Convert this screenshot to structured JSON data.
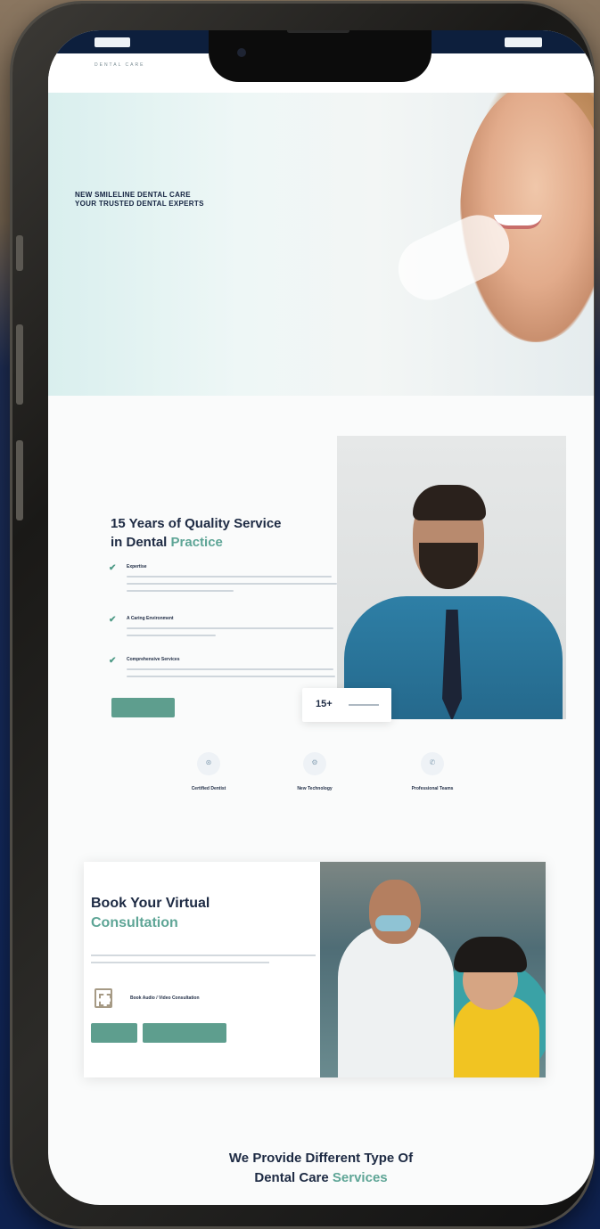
{
  "topbar": {
    "left_pill": "",
    "phone": "",
    "right_pill": ""
  },
  "nav": {
    "logo_mark": "",
    "logo_sub": "DENTAL CARE",
    "items": [
      "",
      "",
      ""
    ]
  },
  "hero": {
    "title_line1": "NEW SMILELINE DENTAL CARE",
    "title_line2": "YOUR TRUSTED DENTAL EXPERTS",
    "subtitle": ""
  },
  "quality": {
    "title_line1": "15 Years of Quality Service",
    "title_line2_plain": "in Dental",
    "title_line2_accent": "Practice",
    "features": [
      {
        "name": "Expertise"
      },
      {
        "name": "A Caring Environment"
      },
      {
        "name": "Comprehensive Services"
      }
    ],
    "button_label": "",
    "stat_number": "15+"
  },
  "badges": [
    {
      "label": "Certified Dentist",
      "icon": "tooth-icon"
    },
    {
      "label": "New Technology",
      "icon": "gear-icon"
    },
    {
      "label": "Professional Teams",
      "icon": "phone-icon"
    }
  ],
  "consult": {
    "title_line1": "Book Your Virtual",
    "title_line2": "Consultation",
    "feature": "Book Audio / Video Consultation",
    "button1": "",
    "button2": ""
  },
  "services": {
    "title_line1": "We Provide Different Type Of",
    "title_line2_plain": "Dental Care",
    "title_line2_accent": "Services"
  },
  "colors": {
    "accent": "#5ea596",
    "navy": "#0d1f3d",
    "button": "#5e9e8e"
  }
}
